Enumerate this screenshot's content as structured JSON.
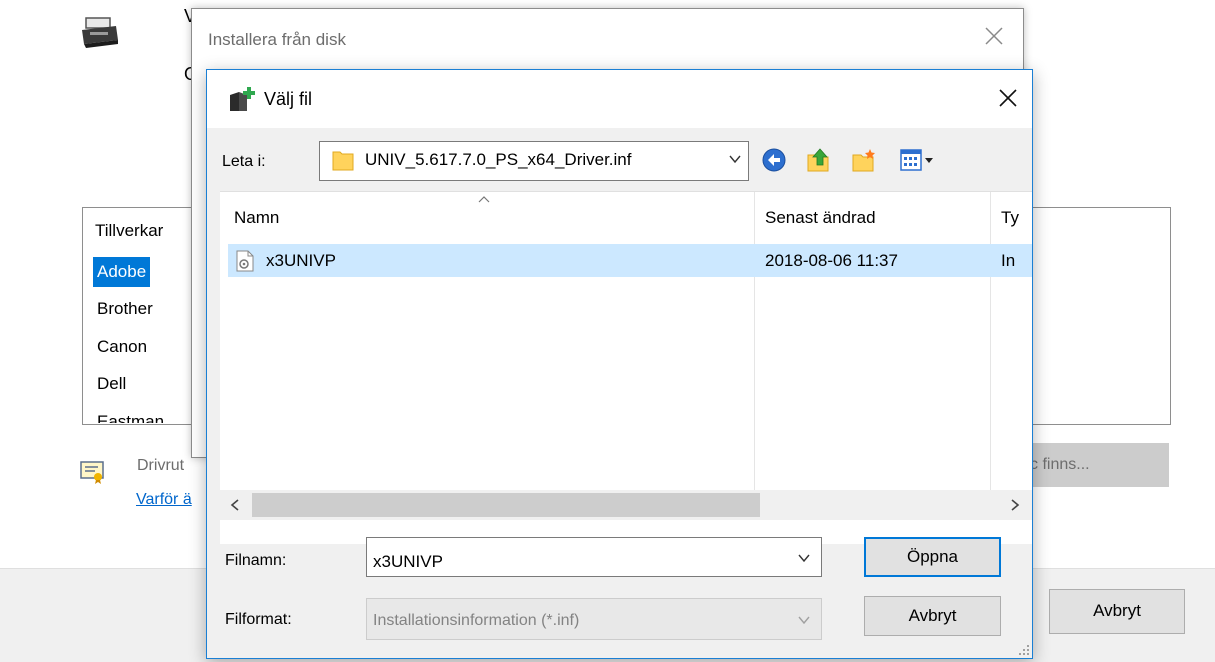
{
  "background_wizard": {
    "title_fragment": "V",
    "subtitle_fragment": "O",
    "list_header": "Tillverkar",
    "manufacturers": [
      {
        "label": "Adobe",
        "selected": true
      },
      {
        "label": "Brother",
        "selected": false
      },
      {
        "label": "Canon",
        "selected": false
      },
      {
        "label": "Dell",
        "selected": false
      },
      {
        "label": "Eastman",
        "selected": false
      }
    ],
    "driver_message_fragment": "Drivrut",
    "why_link_fragment": "Varför ä",
    "have_disk_button_fragment": "c finns...",
    "cancel_label": "Avbryt",
    "icons": {
      "printer": "printer-icon",
      "certificate": "certificate-icon"
    }
  },
  "install_from_disk": {
    "title": "Installera från disk"
  },
  "choose_file_dialog": {
    "title": "Välj fil",
    "look_in_label": "Leta i:",
    "look_in_value": "UNIV_5.617.7.0_PS_x64_Driver.inf",
    "toolbar_icons": [
      "back-icon",
      "up-folder-icon",
      "new-folder-icon",
      "view-menu-icon"
    ],
    "columns": [
      "Namn",
      "Senast ändrad",
      "Ty"
    ],
    "files": [
      {
        "name": "x3UNIVP",
        "modified": "2018-08-06 11:37",
        "type": "In"
      }
    ],
    "filename_label": "Filnamn:",
    "filename_value": "x3UNIVP",
    "filetype_label": "Filformat:",
    "filetype_value": "Installationsinformation (*.inf)",
    "open_label": "Öppna",
    "cancel_label": "Avbryt"
  },
  "colors": {
    "accent": "#0078d7",
    "selection": "#cce8ff",
    "link": "#0066cc"
  }
}
